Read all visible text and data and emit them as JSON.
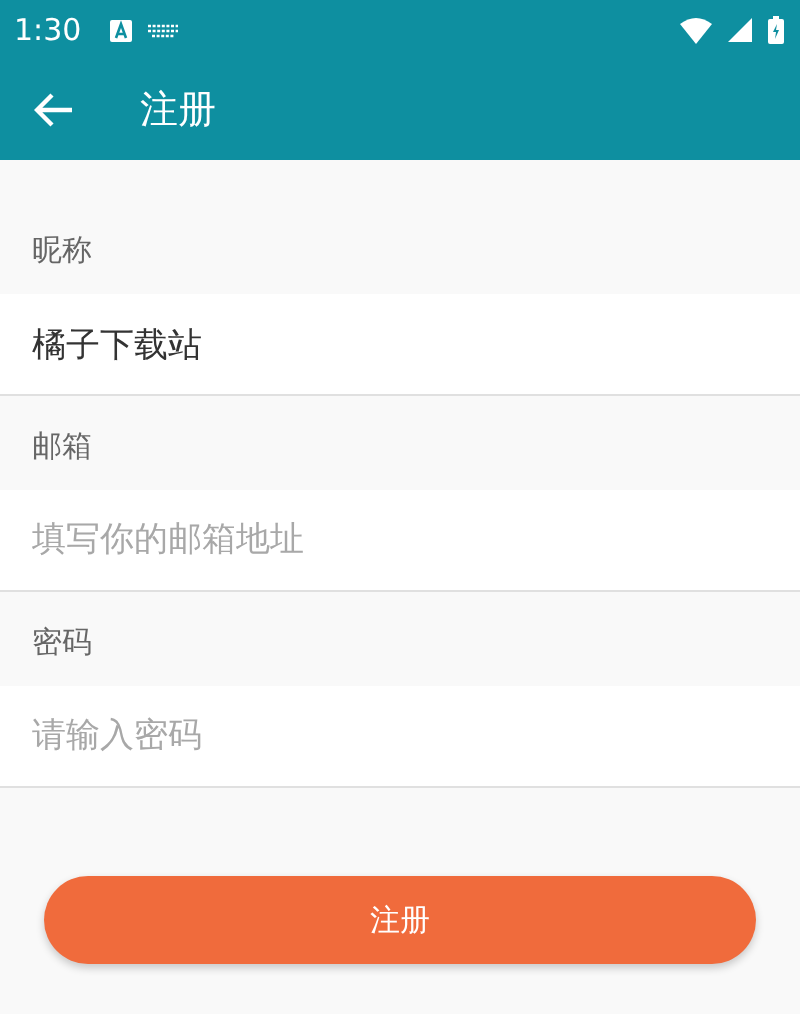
{
  "status_bar": {
    "time": "1:30"
  },
  "toolbar": {
    "title": "注册"
  },
  "fields": [
    {
      "label": "昵称",
      "value": "橘子下载站"
    },
    {
      "label": "邮箱",
      "placeholder": "填写你的邮箱地址"
    },
    {
      "label": "密码",
      "placeholder": "请输入密码"
    }
  ],
  "submit_button": "注册"
}
